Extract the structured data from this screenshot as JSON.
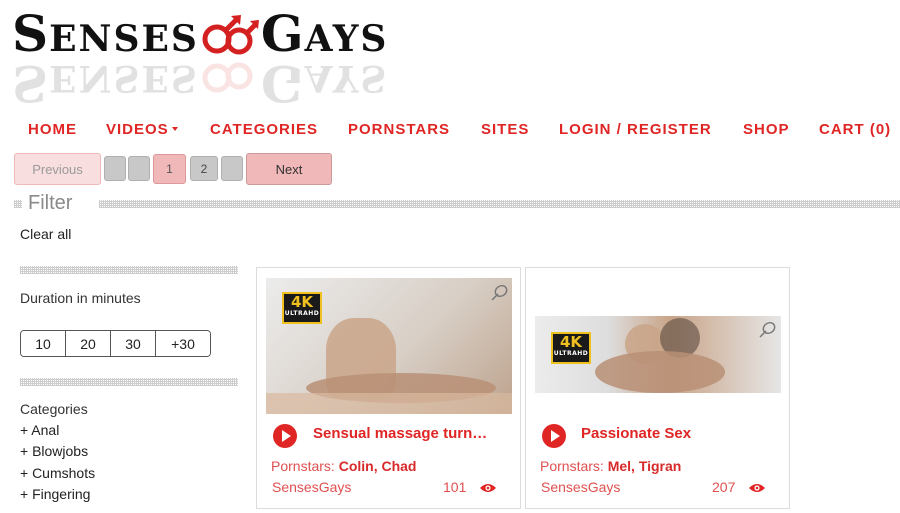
{
  "logo": {
    "text_left": "Senses",
    "text_right": "Gays",
    "icon": "male-male-symbol-icon"
  },
  "nav": {
    "items": [
      "HOME",
      "VIDEOS",
      "CATEGORIES",
      "PORNSTARS",
      "SITES",
      "LOGIN / REGISTER",
      "SHOP",
      "CART (0)"
    ]
  },
  "pagination": {
    "previous": "Previous",
    "pages": [
      "1",
      "2"
    ],
    "current": "1",
    "next": "Next"
  },
  "filter": {
    "title": "Filter",
    "clear_all": "Clear all",
    "duration_label": "Duration in minutes",
    "duration_options": [
      "10",
      "20",
      "30",
      "+30"
    ],
    "categories_label": "Categories",
    "categories": [
      "+ Anal",
      "+ Blowjobs",
      "+ Cumshots",
      "+ Fingering"
    ]
  },
  "videos": [
    {
      "title": "Sensual massage turn…",
      "pornstars_label": "Pornstars:",
      "pornstars": "Colin, Chad",
      "site": "SensesGays",
      "views": "101",
      "badge": "4K",
      "badge_sub": "ULTRAHD"
    },
    {
      "title": "Passionate Sex",
      "pornstars_label": "Pornstars:",
      "pornstars": "Mel, Tigran",
      "site": "SensesGays",
      "views": "207",
      "badge": "4K",
      "badge_sub": "ULTRAHD"
    }
  ],
  "colors": {
    "accent": "#e02525",
    "pager_active": "#f0b8b8",
    "muted": "#8a8a8a"
  }
}
